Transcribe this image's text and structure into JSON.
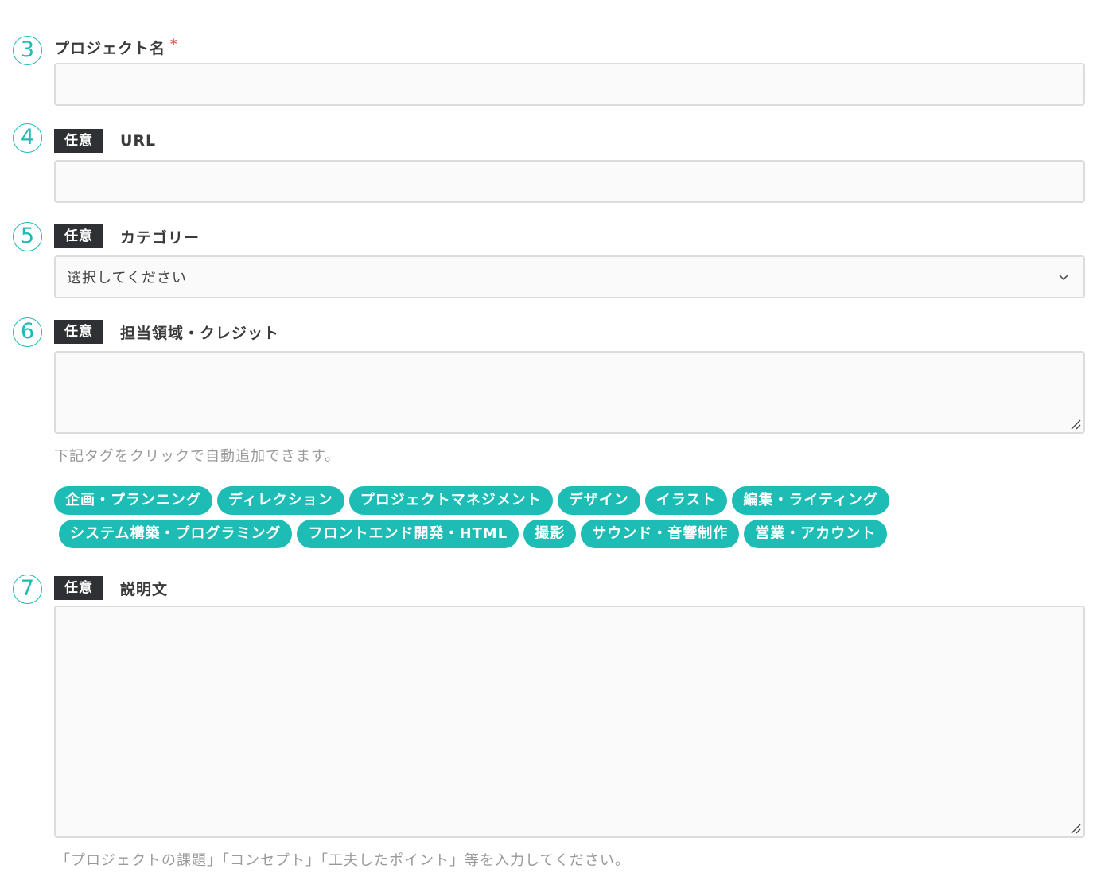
{
  "colors": {
    "accent": "#1dbdb6",
    "badge_bg": "#2f3033",
    "required": "#e05050",
    "hint": "#9a9a9a",
    "field_bg": "#fafafa",
    "field_border": "#dcdcdc"
  },
  "fields": {
    "project_name": {
      "step": "3",
      "label": "プロジェクト名",
      "required_mark": "*",
      "value": ""
    },
    "url": {
      "step": "4",
      "badge": "任意",
      "label": "URL",
      "value": ""
    },
    "category": {
      "step": "5",
      "badge": "任意",
      "label": "カテゴリー",
      "selected": "選択してください"
    },
    "credits": {
      "step": "6",
      "badge": "任意",
      "label": "担当領域・クレジット",
      "value": "",
      "hint": "下記タグをクリックで自動追加できます。",
      "tags_row1": [
        "企画・プランニング",
        "ディレクション",
        "プロジェクトマネジメント",
        "デザイン",
        "イラスト",
        "編集・ライティング"
      ],
      "tags_row2": [
        "システム構築・プログラミング",
        "フロントエンド開発・HTML",
        "撮影",
        "サウンド・音響制作",
        "営業・アカウント"
      ]
    },
    "description": {
      "step": "7",
      "badge": "任意",
      "label": "説明文",
      "value": "",
      "hint": "「プロジェクトの課題」「コンセプト」「工夫したポイント」等を入力してください。"
    }
  },
  "icons": {
    "select_arrow": "chevron-down-icon",
    "textarea_grip": "resize-grip-icon"
  }
}
